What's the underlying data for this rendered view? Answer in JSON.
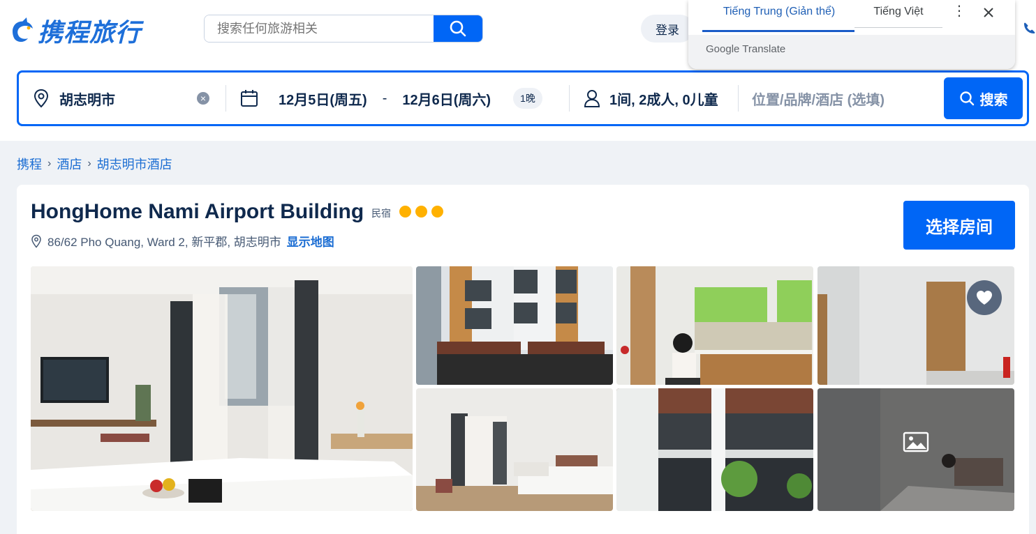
{
  "header": {
    "logo_text": "携程旅行",
    "search_placeholder": "搜索任何旅游相关",
    "login_label": "登录"
  },
  "translate_popup": {
    "tab_active": "Tiếng Trung (Giản thể)",
    "tab_inactive": "Tiếng Việt",
    "menu_glyph": "⋮",
    "brand": "Google Translate"
  },
  "search_bar": {
    "destination": "胡志明市",
    "clear_glyph": "×",
    "checkin": "12月5日(周五)",
    "date_separator": "-",
    "checkout": "12月6日(周六)",
    "nights": "1晚",
    "guests": "1间, 2成人, 0儿童",
    "keyword_placeholder": "位置/品牌/酒店 (选填)",
    "search_label": "搜索"
  },
  "breadcrumb": {
    "items": [
      "携程",
      "酒店",
      "胡志明市酒店"
    ],
    "separator": "›"
  },
  "hotel": {
    "name": "HongHome Nami Airport Building",
    "type": "民宿",
    "star_count": 3,
    "address": "86/62 Pho Quang, Ward 2, 新平郡, 胡志明市",
    "map_link": "显示地图",
    "choose_room_label": "选择房间"
  },
  "colors": {
    "brand_blue": "#0066f6",
    "link_blue": "#1b6dd3",
    "star_gold": "#ffb100",
    "text_dark": "#0f294d"
  },
  "icons": [
    "search-icon",
    "location-pin-icon",
    "calendar-icon",
    "person-icon",
    "heart-icon",
    "gallery-icon",
    "close-icon",
    "menu-dots-icon"
  ]
}
